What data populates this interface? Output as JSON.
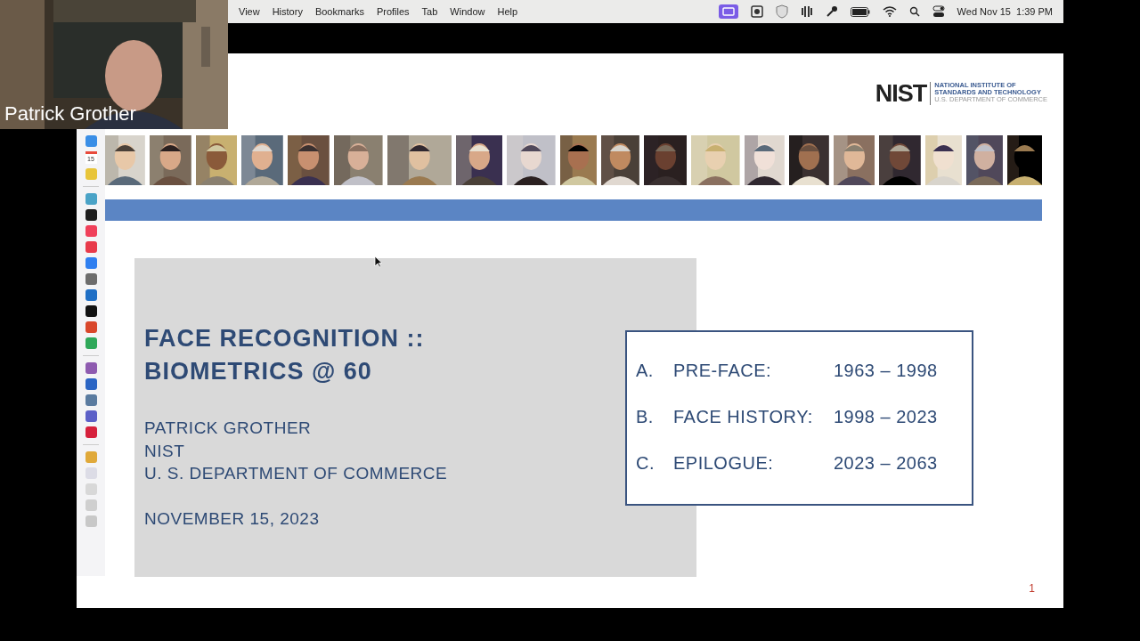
{
  "webcam": {
    "kind": "picture",
    "name": "Patrick Grother"
  },
  "menu_bar": {
    "items": [
      "View",
      "History",
      "Bookmarks",
      "Profiles",
      "Tab",
      "Window",
      "Help"
    ],
    "clock": "Wed Nov 15  1:39 PM"
  },
  "dock": {
    "items": [
      {
        "kind": "app",
        "color": "#3a8ee6"
      },
      {
        "kind": "calendar",
        "color": "#e84a3c",
        "label": "15"
      },
      {
        "kind": "app",
        "color": "#e8c53a"
      },
      {
        "kind": "separator"
      },
      {
        "kind": "app",
        "color": "#4aa3c7"
      },
      {
        "kind": "app",
        "color": "#1e1e1e"
      },
      {
        "kind": "app",
        "color": "#f0405a"
      },
      {
        "kind": "app",
        "color": "#e83a4a"
      },
      {
        "kind": "app",
        "color": "#2f7ff0"
      },
      {
        "kind": "app",
        "color": "#6c6c6c"
      },
      {
        "kind": "app",
        "color": "#1f6fc5"
      },
      {
        "kind": "app",
        "color": "#111111"
      },
      {
        "kind": "app",
        "color": "#d9472b"
      },
      {
        "kind": "app",
        "color": "#2fa85a"
      },
      {
        "kind": "separator"
      },
      {
        "kind": "app",
        "color": "#8e5bb0"
      },
      {
        "kind": "app",
        "color": "#2b65c4"
      },
      {
        "kind": "app",
        "color": "#5a7ba0"
      },
      {
        "kind": "app",
        "color": "#5b5fc7"
      },
      {
        "kind": "app",
        "color": "#d6203c"
      },
      {
        "kind": "separator"
      },
      {
        "kind": "app",
        "color": "#e0a93a"
      },
      {
        "kind": "app",
        "color": "#dcdce6"
      },
      {
        "kind": "app",
        "color": "#d8d8d8"
      },
      {
        "kind": "app",
        "color": "#cfcfcf"
      },
      {
        "kind": "app",
        "color": "#c8c8c8"
      }
    ]
  },
  "slide": {
    "logo": {
      "mark": "NIST",
      "lines": [
        "NATIONAL INSTITUTE OF",
        "STANDARDS AND TECHNOLOGY",
        "U.S. DEPARTMENT OF COMMERCE"
      ]
    },
    "photo_strip": [
      {
        "kind": "picture"
      },
      {
        "kind": "picture"
      },
      {
        "kind": "picture"
      },
      {
        "kind": "picture"
      },
      {
        "kind": "picture"
      },
      {
        "kind": "picture"
      },
      {
        "kind": "picture"
      },
      {
        "kind": "picture"
      },
      {
        "kind": "picture"
      },
      {
        "kind": "picture"
      },
      {
        "kind": "picture"
      },
      {
        "kind": "picture"
      },
      {
        "kind": "picture"
      },
      {
        "kind": "picture"
      },
      {
        "kind": "picture"
      },
      {
        "kind": "picture"
      },
      {
        "kind": "picture"
      },
      {
        "kind": "picture"
      },
      {
        "kind": "picture"
      },
      {
        "kind": "picture"
      }
    ],
    "title": [
      "FACE RECOGNITION ::",
      "BIOMETRICS @ 60"
    ],
    "author": [
      "PATRICK GROTHER",
      "NIST",
      "U. S. DEPARTMENT OF COMMERCE"
    ],
    "date": "NOVEMBER 15, 2023",
    "agenda": [
      {
        "letter": "A.",
        "label": "PRE-FACE:",
        "years": "1963 – 1998"
      },
      {
        "letter": "B.",
        "label": "FACE HISTORY:",
        "years": "1998 – 2023"
      },
      {
        "letter": "C.",
        "label": "EPILOGUE:",
        "years": "2023 – 2063"
      }
    ],
    "page_number": "1"
  }
}
